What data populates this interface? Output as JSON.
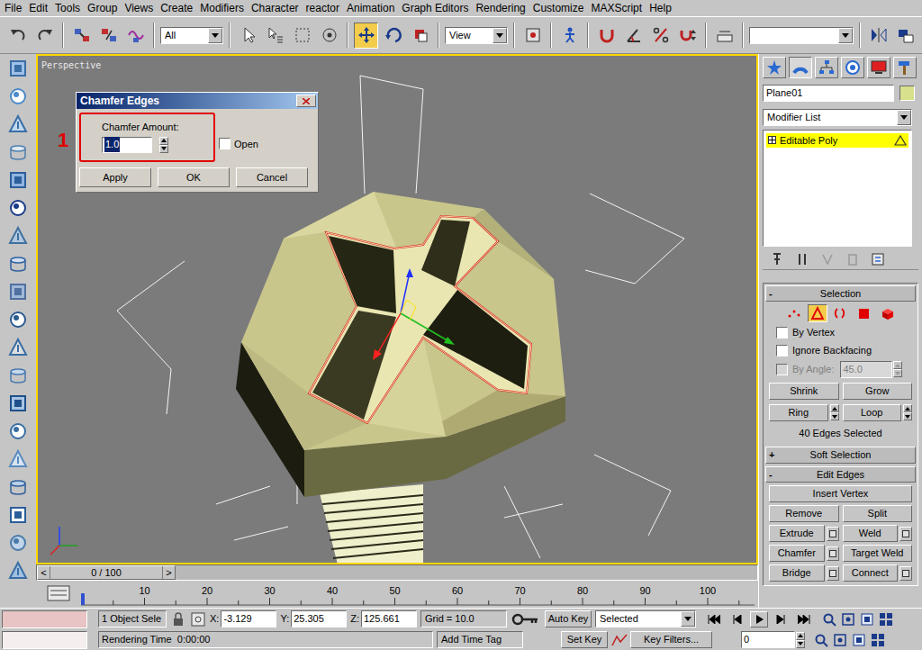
{
  "menu": [
    "File",
    "Edit",
    "Tools",
    "Group",
    "Views",
    "Create",
    "Modifiers",
    "Character",
    "reactor",
    "Animation",
    "Graph Editors",
    "Rendering",
    "Customize",
    "MAXScript",
    "Help"
  ],
  "toolbar": [
    {
      "kind": "buttons",
      "buttons": [
        {
          "selected": false
        },
        {
          "selected": false
        }
      ]
    },
    {
      "kind": "buttons",
      "buttons": [
        {
          "selected": false
        },
        {
          "selected": false
        },
        {
          "selected": false
        }
      ]
    },
    {
      "kind": "dropdown",
      "value": "All"
    },
    {
      "kind": "buttons",
      "buttons": [
        {
          "selected": false
        },
        {
          "selected": false
        },
        {
          "selected": false
        },
        {
          "selected": false
        }
      ]
    },
    {
      "kind": "buttons",
      "buttons": [
        {
          "selected": true
        },
        {
          "selected": false
        },
        {
          "selected": false
        }
      ]
    },
    {
      "kind": "dropdown",
      "value": "View"
    },
    {
      "kind": "buttons",
      "buttons": [
        {
          "selected": false
        }
      ]
    },
    {
      "kind": "buttons",
      "buttons": [
        {
          "selected": false
        }
      ]
    },
    {
      "kind": "buttons",
      "buttons": [
        {
          "selected": false
        },
        {
          "selected": false
        },
        {
          "selected": false
        },
        {
          "selected": false
        }
      ]
    },
    {
      "kind": "buttons",
      "buttons": [
        {
          "selected": false
        }
      ]
    },
    {
      "kind": "dropdown",
      "value": ""
    },
    {
      "kind": "buttons",
      "buttons": [
        {
          "selected": false
        },
        {
          "selected": false
        },
        {
          "selected": false
        }
      ]
    }
  ],
  "viewport": {
    "label": "Perspective",
    "active": true
  },
  "dialog": {
    "title": "Chamfer Edges",
    "field_label": "Chamfer Amount:",
    "value": "1.0",
    "open": {
      "label": "Open",
      "checked": false
    },
    "buttons": [
      "Apply",
      "OK",
      "Cancel"
    ]
  },
  "annotation": {
    "number": "1",
    "color": "#e00000"
  },
  "command_panel": {
    "tabs": [
      {
        "selected": false
      },
      {
        "selected": true
      },
      {
        "selected": false
      },
      {
        "selected": false
      },
      {
        "selected": false
      },
      {
        "selected": false
      }
    ],
    "object_name": "Plane01",
    "object_color": "#d8e08c",
    "modifier_list": "Modifier List",
    "stack": [
      {
        "label": "Editable Poly",
        "selected": true
      }
    ],
    "selection": {
      "title": "Selection",
      "toggle": "-",
      "levels": [
        {
          "selected": false
        },
        {
          "selected": true
        },
        {
          "selected": false
        },
        {
          "selected": false
        },
        {
          "selected": false
        }
      ],
      "checkboxes": [
        {
          "label": "By Vertex",
          "checked": false,
          "disabled": false
        },
        {
          "label": "Ignore Backfacing",
          "checked": false,
          "disabled": false
        },
        {
          "label": "By Angle:",
          "checked": false,
          "disabled": true,
          "value": "45.0"
        }
      ],
      "button_rows": [
        [
          {
            "label": "Shrink",
            "spinner": false
          },
          {
            "label": "Grow",
            "spinner": false
          }
        ],
        [
          {
            "label": "Ring",
            "spinner": true
          },
          {
            "label": "Loop",
            "spinner": true
          }
        ]
      ],
      "status": "40 Edges Selected"
    },
    "soft_selection": {
      "title": "Soft Selection",
      "toggle": "+"
    },
    "edit_edges": {
      "title": "Edit Edges",
      "toggle": "-",
      "rows": [
        [
          {
            "label": "Insert Vertex",
            "settings": false
          }
        ],
        [
          {
            "label": "Remove",
            "settings": false
          },
          {
            "label": "Split",
            "settings": false
          }
        ],
        [
          {
            "label": "Extrude",
            "settings": true
          },
          {
            "label": "Weld",
            "settings": true
          }
        ],
        [
          {
            "label": "Chamfer",
            "settings": true
          },
          {
            "label": "Target Weld",
            "settings": false
          }
        ],
        [
          {
            "label": "Bridge",
            "settings": true
          },
          {
            "label": "Connect",
            "settings": true
          }
        ]
      ]
    }
  },
  "time_slider": {
    "value": "0 / 100",
    "prev": "<",
    "next": ">"
  },
  "track_bar": {
    "ticks": [
      "10",
      "20",
      "30",
      "40",
      "50",
      "60",
      "70",
      "80",
      "90",
      "100"
    ]
  },
  "status_bar": {
    "selection": "1 Object Sele",
    "coords": [
      {
        "label": "X:",
        "value": "-3.129"
      },
      {
        "label": "Y:",
        "value": "25.305"
      },
      {
        "label": "Z:",
        "value": "125.661"
      }
    ],
    "grid": "Grid = 10.0",
    "auto_key": "Auto Key",
    "key_mode": "Selected",
    "set_key": "Set Key",
    "key_filters": "Key Filters...",
    "frame": "0",
    "rendering_time": "Rendering Time  0:00:00",
    "add_time_tag": "Add Time Tag"
  }
}
